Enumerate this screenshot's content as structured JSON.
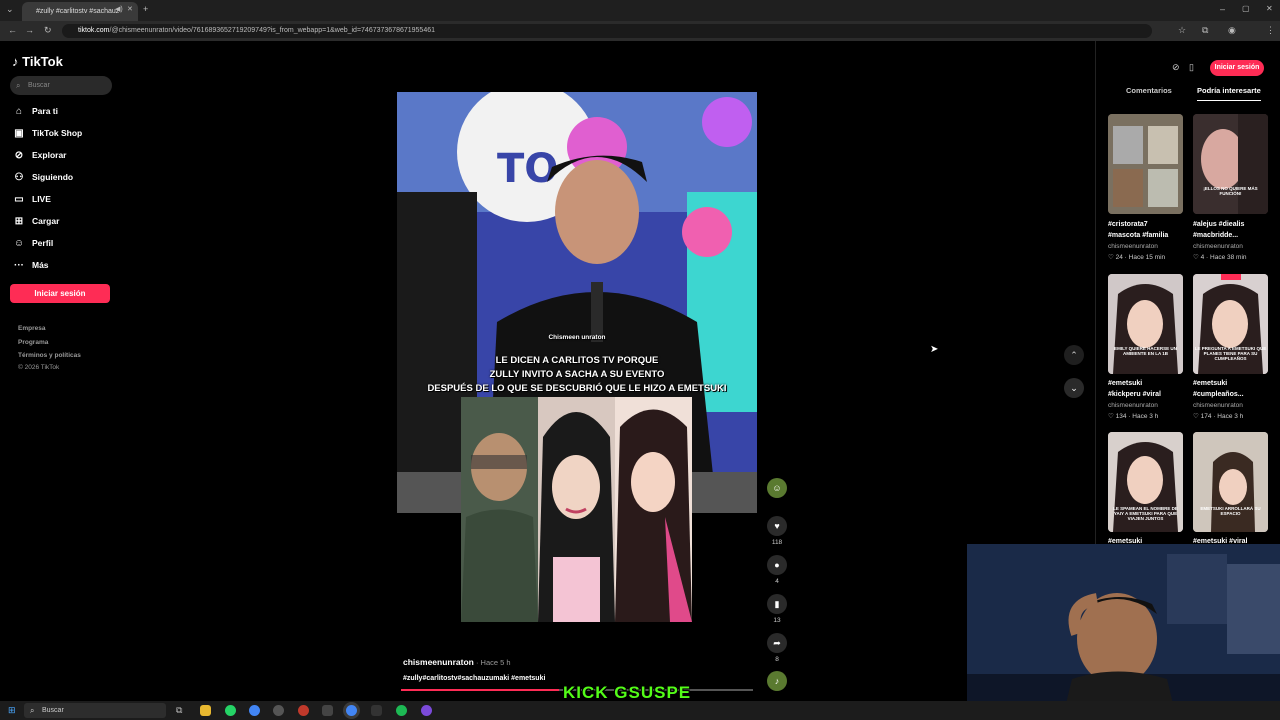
{
  "browser": {
    "tab_title": "#zully #carlitostv #sachauz",
    "url_domain": "tiktok.com",
    "url_path": "/@chismeenunraton/video/7616893652719209749?is_from_webapp=1&web_id=7467373678671955461"
  },
  "tiktok": {
    "logo": "TikTok",
    "search_placeholder": "Buscar",
    "nav": [
      {
        "label": "Para ti",
        "icon": "home-icon"
      },
      {
        "label": "TikTok Shop",
        "icon": "shop-icon"
      },
      {
        "label": "Explorar",
        "icon": "compass-icon"
      },
      {
        "label": "Siguiendo",
        "icon": "person-icon"
      },
      {
        "label": "LIVE",
        "icon": "live-icon"
      },
      {
        "label": "Cargar",
        "icon": "upload-icon"
      },
      {
        "label": "Perfil",
        "icon": "profile-icon"
      },
      {
        "label": "Más",
        "icon": "more-icon"
      }
    ],
    "login_button": "Iniciar sesión",
    "footer": [
      "Empresa",
      "Programa",
      "Términos y políticas",
      "© 2026 TikTok"
    ]
  },
  "video": {
    "watermark": "Chismeen   unraton",
    "caption_lines": [
      "LE DICEN A CARLITOS TV PORQUE",
      "ZULLY INVITO A SACHA A SU EVENTO",
      "DESPUÉS DE LO QUE SE DESCUBRIÓ QUE LE HIZO A EMETSUKI"
    ],
    "author": "chismeenunraton",
    "time": " · Hace 5 h",
    "hashtags": "#zully#carlitostv#sachauzumaki #emetsuki",
    "progress": 0.45,
    "likes": "118",
    "comments": "4",
    "saves": "13",
    "shares": "8"
  },
  "right_panel": {
    "login_button": "Iniciar sesión",
    "tabs": [
      "Comentarios",
      "Podría interesarte"
    ],
    "cards": [
      {
        "title1": "#cristorata7",
        "title2": "#mascota #familia",
        "author": "chismeenunraton",
        "stats": "♡ 24 · Hace 15 min"
      },
      {
        "title1": "#alejus #diealis",
        "title2": "#macbridde...",
        "author": "chismeenunraton",
        "stats": "♡ 4 · Hace 38 min"
      },
      {
        "title1": "#emetsuki",
        "title2": "#kickperu #viral",
        "author": "chismeenunraton",
        "stats": "♡ 134 · Hace 3 h"
      },
      {
        "title1": "#emetsuki",
        "title2": "#cumpleaños...",
        "author": "chismeenunraton",
        "stats": "♡ 174 · Hace 3 h"
      },
      {
        "title1": "#emetsuki",
        "title2": "",
        "author": "",
        "stats": ""
      },
      {
        "title1": "#emetsuki #viral",
        "title2": "",
        "author": "",
        "stats": ""
      }
    ],
    "thumb_texts": [
      "",
      "¡ELLOS NO QUIERE MÁS FUNCIÓN!",
      "EMILY QUIERE HACERSE UN AMBIENTE EN LA 1B",
      "LE PREGUNTA A EMETSUKI QUE PLANES TIENE PARA SU CUMPLEAÑOS",
      "LE SPAMEAN EL NOMBRE DE YAIY A EMETSUKI PARA QUE VIAJEN JUNTOS",
      "EMETSUKI ARROLLARÁ SU ESPACIO"
    ]
  },
  "overlay": {
    "kick_text": "KICK GSUSPE"
  },
  "taskbar": {
    "search": "Buscar"
  },
  "colors": {
    "accent": "#fe2c55",
    "kick": "#53fc18"
  }
}
